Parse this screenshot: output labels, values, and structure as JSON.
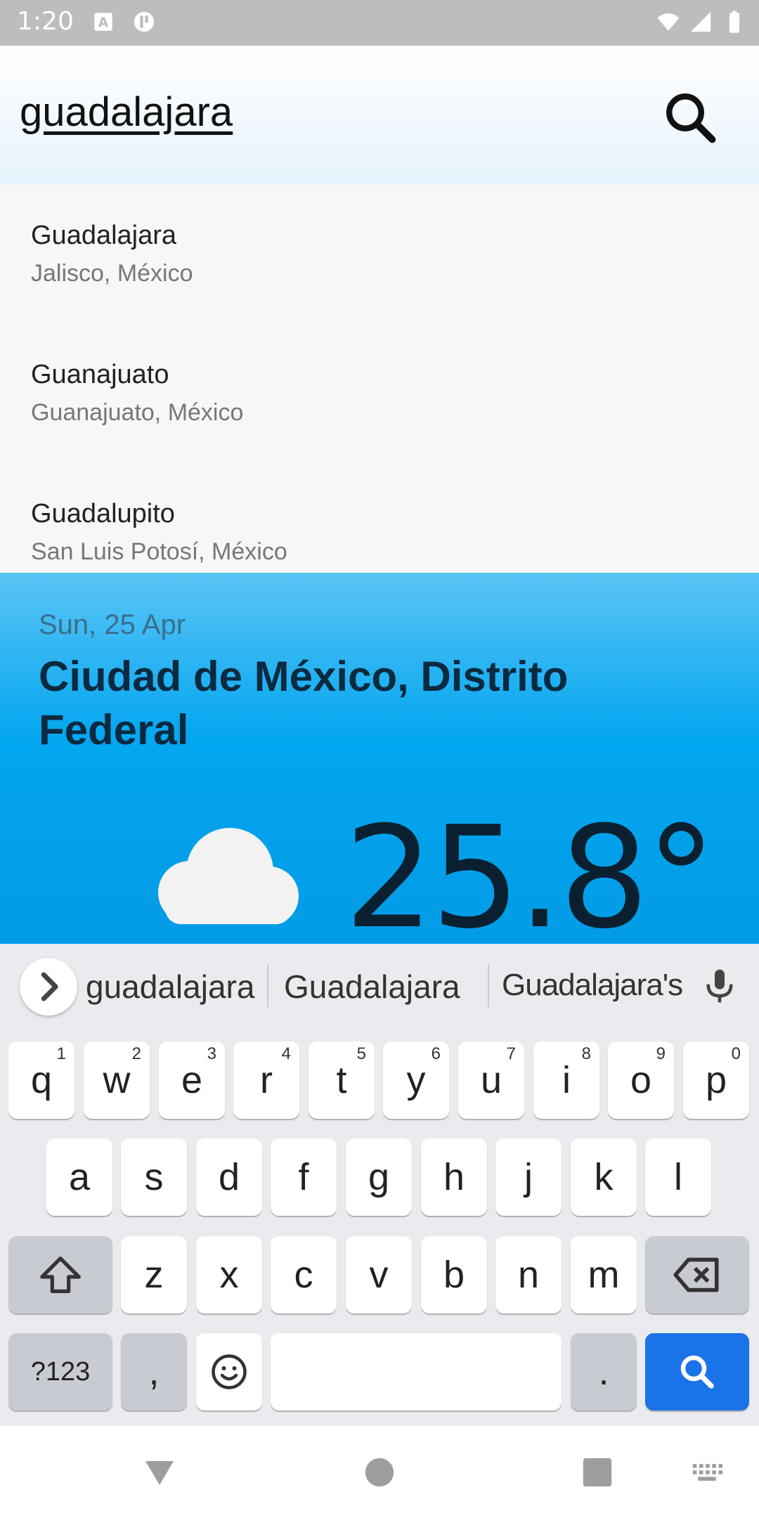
{
  "status": {
    "time": "1:20"
  },
  "search": {
    "query": "guadalajara"
  },
  "results": [
    {
      "name": "Guadalajara",
      "region": "Jalisco, México"
    },
    {
      "name": "Guanajuato",
      "region": "Guanajuato, México"
    },
    {
      "name": "Guadalupito",
      "region": "San Luis Potosí, México"
    }
  ],
  "weather": {
    "date": "Sun, 25 Apr",
    "city": "Ciudad de México, Distrito Federal",
    "temperature": "25.8°",
    "icon": "cloud-icon"
  },
  "keyboard": {
    "suggestions": [
      "guadalajara",
      "Guadalajara",
      "Guadalajara's"
    ],
    "row1": [
      {
        "k": "q",
        "h": "1"
      },
      {
        "k": "w",
        "h": "2"
      },
      {
        "k": "e",
        "h": "3"
      },
      {
        "k": "r",
        "h": "4"
      },
      {
        "k": "t",
        "h": "5"
      },
      {
        "k": "y",
        "h": "6"
      },
      {
        "k": "u",
        "h": "7"
      },
      {
        "k": "i",
        "h": "8"
      },
      {
        "k": "o",
        "h": "9"
      },
      {
        "k": "p",
        "h": "0"
      }
    ],
    "row2": [
      "a",
      "s",
      "d",
      "f",
      "g",
      "h",
      "j",
      "k",
      "l"
    ],
    "row3": [
      "z",
      "x",
      "c",
      "v",
      "b",
      "n",
      "m"
    ],
    "symbols_label": "?123",
    "comma_label": ",",
    "period_label": ".",
    "accent_color": "#1a73e8"
  }
}
